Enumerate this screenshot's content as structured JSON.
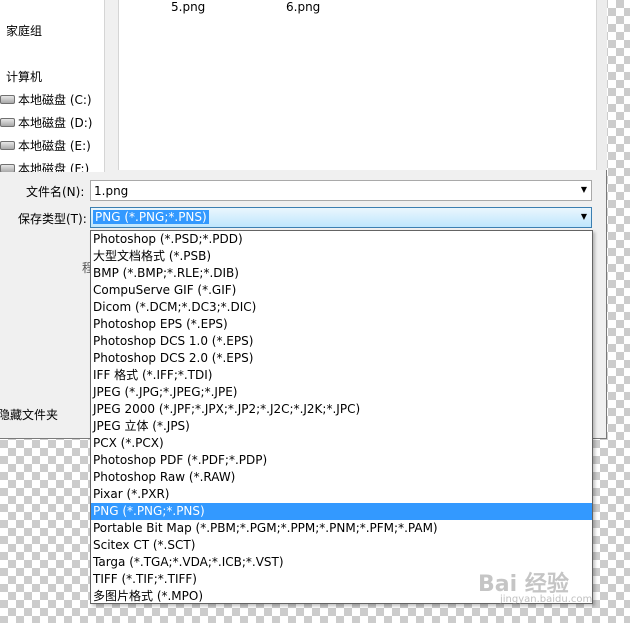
{
  "nav": {
    "homegroup": "家庭组",
    "computer": "计算机",
    "drives": [
      "本地磁盘 (C:)",
      "本地磁盘 (D:)",
      "本地磁盘 (E:)",
      "本地磁盘 (F:)"
    ]
  },
  "files": [
    "5.png",
    "6.png"
  ],
  "filename": {
    "label": "文件名(N):",
    "value": "1.png"
  },
  "savetype": {
    "label": "保存类型(T):",
    "value": "PNG (*.PNG;*.PNS)"
  },
  "behind": {
    "fragment": "程",
    "hide_folders": "隐藏文件夹"
  },
  "options": [
    "Photoshop (*.PSD;*.PDD)",
    "大型文档格式 (*.PSB)",
    "BMP (*.BMP;*.RLE;*.DIB)",
    "CompuServe GIF (*.GIF)",
    "Dicom (*.DCM;*.DC3;*.DIC)",
    "Photoshop EPS (*.EPS)",
    "Photoshop DCS 1.0 (*.EPS)",
    "Photoshop DCS 2.0 (*.EPS)",
    "IFF 格式 (*.IFF;*.TDI)",
    "JPEG (*.JPG;*.JPEG;*.JPE)",
    "JPEG 2000 (*.JPF;*.JPX;*.JP2;*.J2C;*.J2K;*.JPC)",
    "JPEG 立体 (*.JPS)",
    "PCX (*.PCX)",
    "Photoshop PDF (*.PDF;*.PDP)",
    "Photoshop Raw (*.RAW)",
    "Pixar (*.PXR)",
    "PNG (*.PNG;*.PNS)",
    "Portable Bit Map (*.PBM;*.PGM;*.PPM;*.PNM;*.PFM;*.PAM)",
    "Scitex CT (*.SCT)",
    "Targa (*.TGA;*.VDA;*.ICB;*.VST)",
    "TIFF (*.TIF;*.TIFF)",
    "多图片格式 (*.MPO)"
  ],
  "selected_index": 16,
  "watermark": {
    "text": "Bai 经验",
    "sub": "jingyan.baidu.com"
  }
}
